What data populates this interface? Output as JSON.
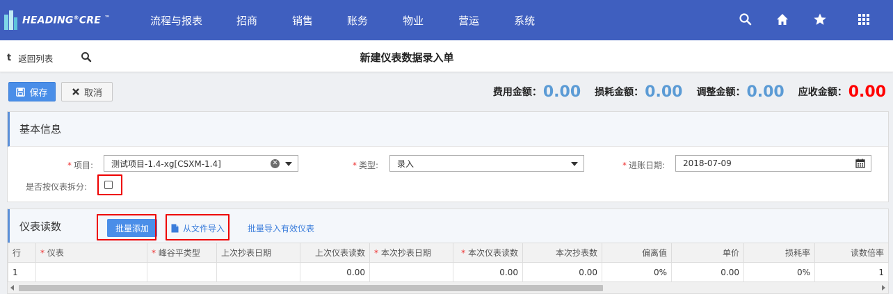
{
  "brand": {
    "name": "HEADING",
    "reg": "®",
    "name2": "CRE",
    "tm": "™"
  },
  "nav": {
    "items": [
      "流程与报表",
      "招商",
      "销售",
      "账务",
      "物业",
      "营运",
      "系统"
    ],
    "icons": [
      "search-icon",
      "home-icon",
      "star-icon",
      "grid-icon"
    ]
  },
  "subheader": {
    "back_label": "返回列表",
    "title": "新建仪表数据录入单"
  },
  "toolbar": {
    "save_label": "保存",
    "cancel_label": "取消"
  },
  "amounts": [
    {
      "label": "费用金额",
      "colon": "：",
      "value": "0.00",
      "color": "#5b9bd5"
    },
    {
      "label": "损耗金额",
      "colon": "：",
      "value": "0.00",
      "color": "#5b9bd5"
    },
    {
      "label": "调整金额",
      "colon": "：",
      "value": "0.00",
      "color": "#5b9bd5"
    },
    {
      "label": "应收金额",
      "colon": "：",
      "value": "0.00",
      "color": "#ff0000"
    }
  ],
  "basic_info": {
    "title": "基本信息",
    "project": {
      "required_mark": "*",
      "label": "项目:",
      "value": "测试项目-1.4-xg[CSXM-1.4]"
    },
    "type": {
      "required_mark": "*",
      "label": "类型:",
      "value": "录入"
    },
    "entry_date": {
      "required_mark": "*",
      "label": "进账日期:",
      "value": "2018-07-09"
    },
    "split_by_meter": {
      "label": "是否按仪表拆分:",
      "checked": false
    }
  },
  "readings": {
    "title": "仪表读数",
    "batch_add_label": "批量添加",
    "import_file_label": "从文件导入",
    "import_valid_label": "批量导入有效仪表",
    "columns": [
      {
        "label": "行",
        "required": false
      },
      {
        "label": "仪表",
        "required": true
      },
      {
        "label": "峰谷平类型",
        "required": true
      },
      {
        "label": "上次抄表日期",
        "required": false
      },
      {
        "label": "上次仪表读数",
        "required": false
      },
      {
        "label": "本次抄表日期",
        "required": true
      },
      {
        "label": "本次仪表读数",
        "required": true
      },
      {
        "label": "本次抄表数",
        "required": false
      },
      {
        "label": "偏离值",
        "required": false
      },
      {
        "label": "单价",
        "required": false
      },
      {
        "label": "损耗率",
        "required": false
      },
      {
        "label": "读数倍率",
        "required": false
      }
    ],
    "rows": [
      [
        "1",
        "",
        "",
        "",
        "0.00",
        "",
        "0.00",
        "0.00",
        "0%",
        "0.00",
        "0%",
        "1"
      ]
    ]
  }
}
